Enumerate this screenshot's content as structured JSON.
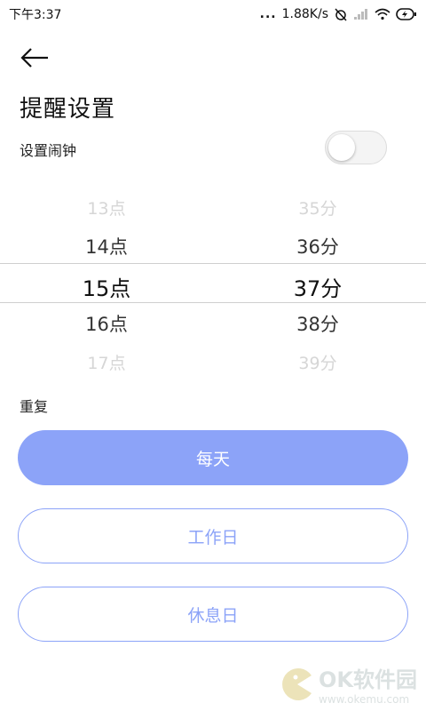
{
  "status_bar": {
    "time": "下午3:37",
    "dots": "...",
    "speed": "1.88K/s"
  },
  "page": {
    "title": "提醒设置",
    "alarm_label": "设置闹钟",
    "alarm_enabled": false,
    "repeat_label": "重复"
  },
  "picker": {
    "hours": [
      "13点",
      "14点",
      "15点",
      "16点",
      "17点"
    ],
    "minutes": [
      "35分",
      "36分",
      "37分",
      "38分",
      "39分"
    ],
    "selected_hour": "15点",
    "selected_minute": "37分"
  },
  "repeat_options": [
    {
      "label": "每天",
      "selected": true
    },
    {
      "label": "工作日",
      "selected": false
    },
    {
      "label": "休息日",
      "selected": false
    }
  ],
  "watermark": {
    "brand": "OK软件园",
    "url": "www.okemu.com"
  },
  "colors": {
    "accent": "#8ca3f8"
  }
}
